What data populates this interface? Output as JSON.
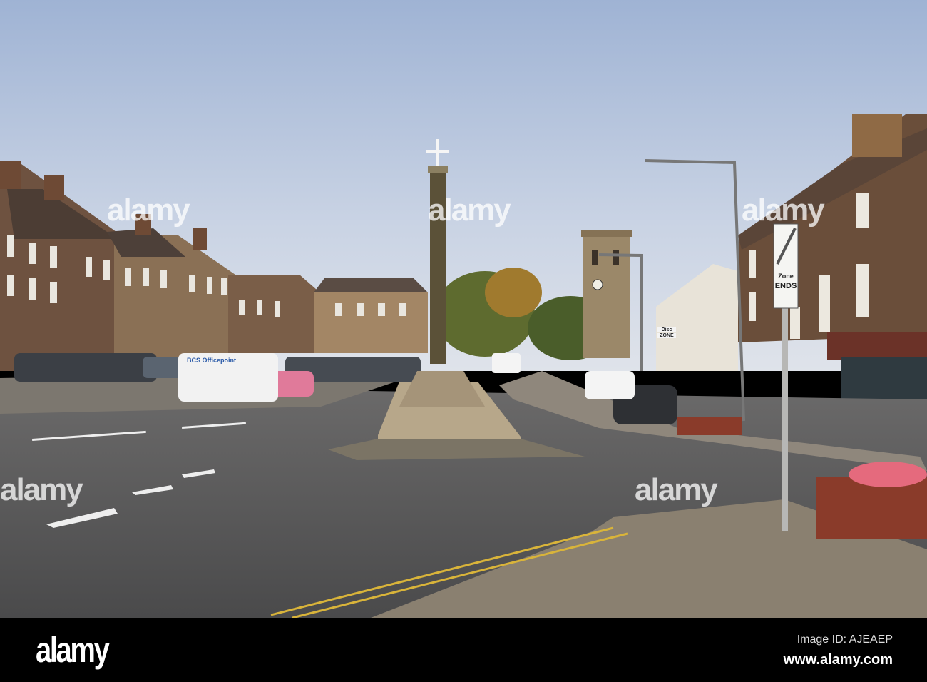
{
  "photo": {
    "subject": "Market cross and street with church tower",
    "signs": {
      "zone_ends_top": "Zone",
      "zone_ends_bottom": "ENDS",
      "disc_zone_top": "Disc",
      "disc_zone_bottom": "ZONE",
      "van_text": "BCS Officepoint"
    },
    "watermark": "alamy"
  },
  "footer": {
    "logo": "alamy",
    "image_id": "Image ID: AJEAEP",
    "url": "www.alamy.com"
  }
}
